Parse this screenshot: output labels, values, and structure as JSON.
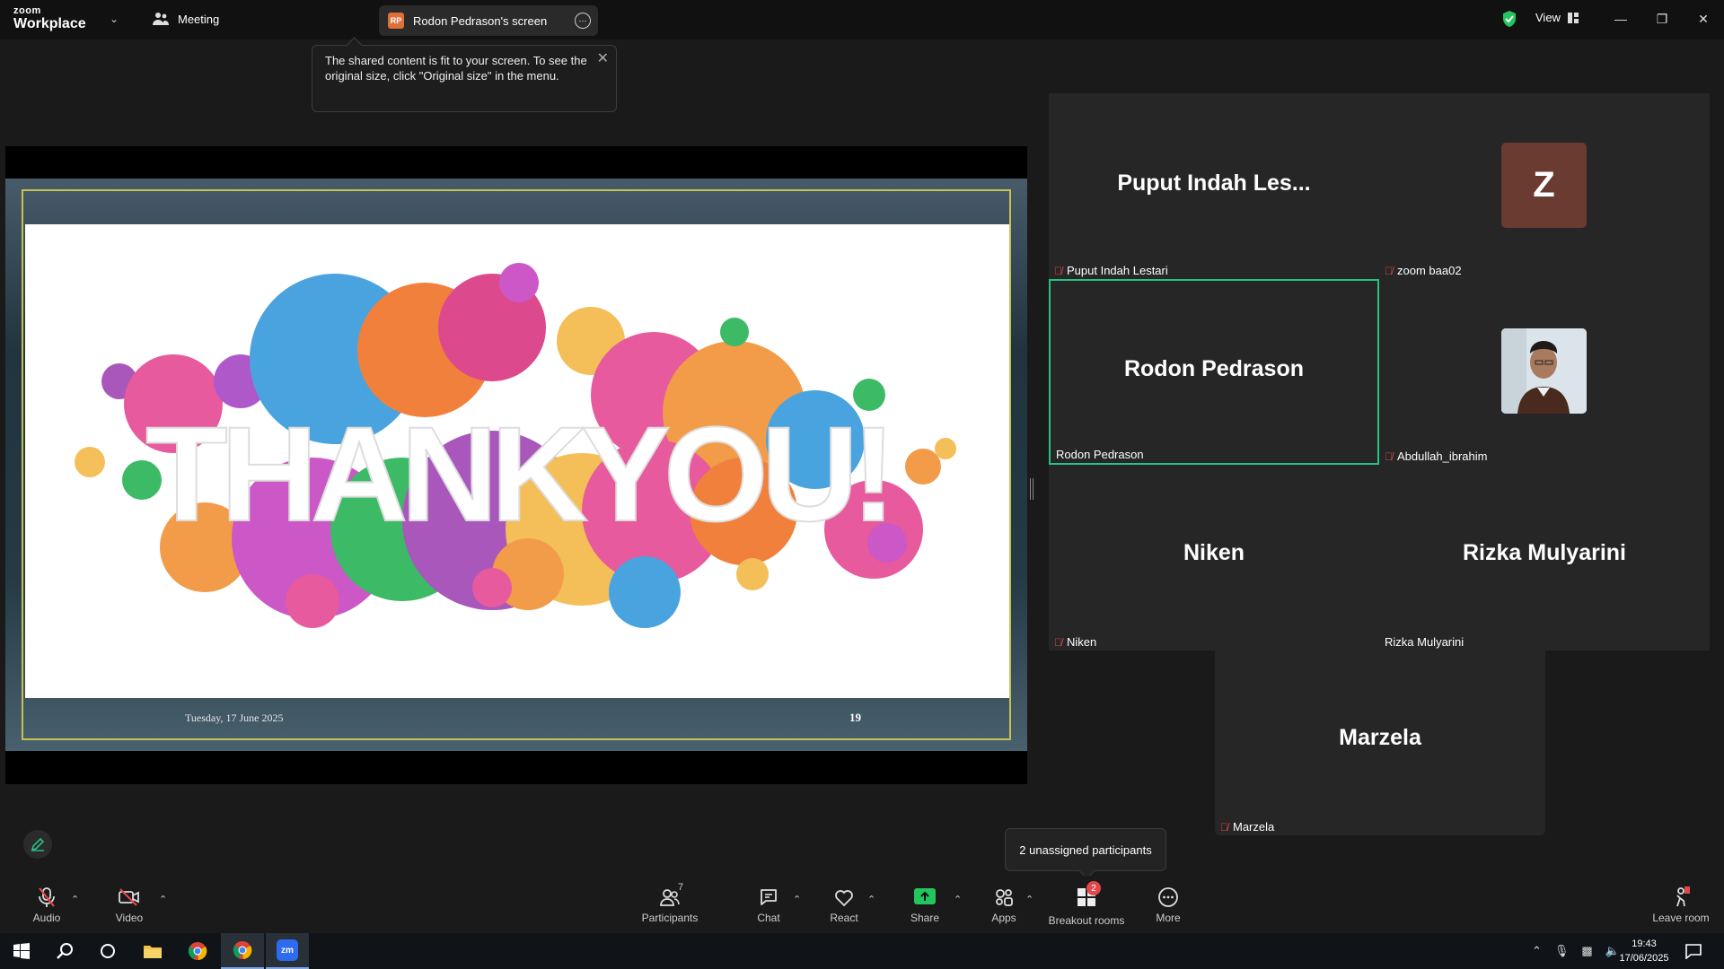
{
  "titlebar": {
    "logo_top": "zoom",
    "logo_bottom": "Workplace",
    "meeting_label": "Meeting",
    "share_tab_initials": "RP",
    "share_tab_label": "Rodon Pedrason's screen",
    "view_label": "View"
  },
  "popup": {
    "text": "The shared content is fit to your screen. To see the original size, click \"Original size\" in the menu."
  },
  "slide": {
    "headline": "THANKYOU!",
    "date": "Tuesday, 17 June 2025",
    "page_number": "19"
  },
  "participants": [
    {
      "big_name": "Puput Indah Les...",
      "label": "Puput Indah Lestari",
      "muted": true
    },
    {
      "avatar_letter": "Z",
      "label": "zoom baa02",
      "muted": true
    },
    {
      "big_name": "Rodon Pedrason",
      "label": "Rodon Pedrason",
      "muted": false,
      "active": true
    },
    {
      "label": "Abdullah_ibrahim",
      "muted": true,
      "has_video": true
    },
    {
      "big_name": "Niken",
      "label": "Niken",
      "muted": true
    },
    {
      "big_name": "Rizka Mulyarini",
      "label": "Rizka Mulyarini",
      "muted": false
    },
    {
      "big_name": "Marzela",
      "label": "Marzela",
      "muted": true
    }
  ],
  "breakout_tip": "2 unassigned participants",
  "toolbar": {
    "audio": "Audio",
    "video": "Video",
    "participants": "Participants",
    "participants_count": "7",
    "chat": "Chat",
    "react": "React",
    "share": "Share",
    "apps": "Apps",
    "breakout": "Breakout rooms",
    "breakout_badge": "2",
    "more": "More",
    "leave": "Leave room"
  },
  "taskbar": {
    "time": "19:43",
    "date": "17/06/2025",
    "zoom_label": "zm"
  },
  "colors": {
    "accent_green": "#27c184",
    "mute_red": "#e0484b",
    "share_green": "#22c55e",
    "slide_frame": "#c7c24d"
  }
}
